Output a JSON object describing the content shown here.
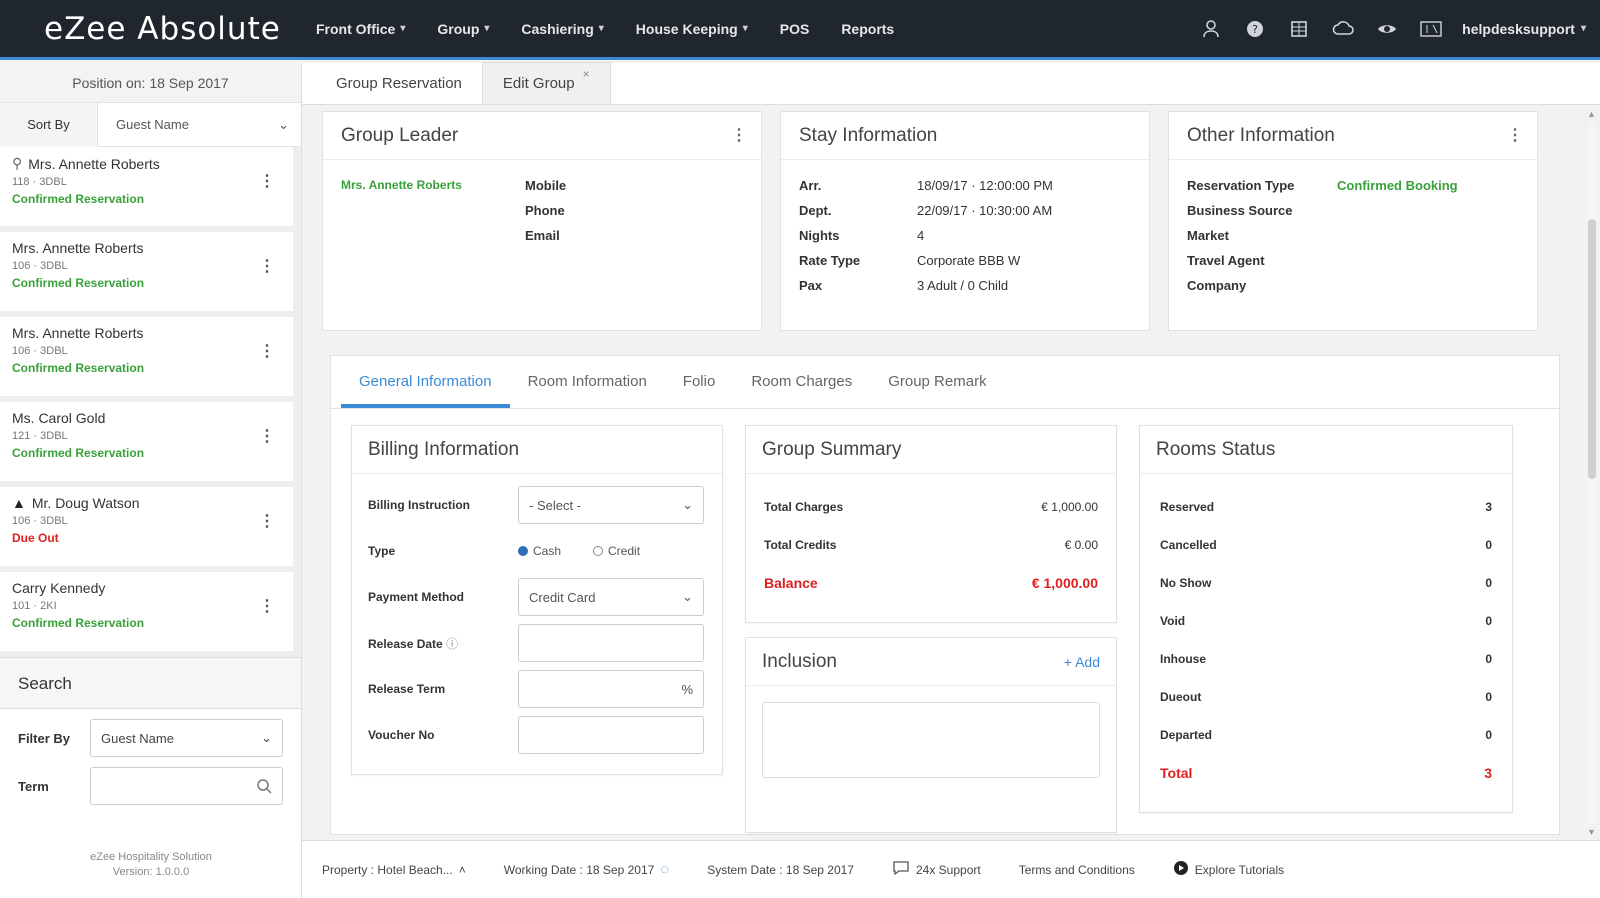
{
  "app": {
    "logo": "eZee Absolute"
  },
  "nav": {
    "menu": [
      "Front Office",
      "Group",
      "Cashiering",
      "House Keeping",
      "POS",
      "Reports"
    ],
    "menu_has_caret": [
      true,
      true,
      true,
      true,
      false,
      false
    ],
    "user": "helpdesksupport",
    "icons": [
      "user-icon",
      "help-icon",
      "grid-icon",
      "cloud-icon",
      "eye-icon",
      "language-icon"
    ]
  },
  "left": {
    "position_on": "Position on: 18 Sep 2017",
    "sort_label": "Sort By",
    "sort_value": "Guest Name",
    "reservations": [
      {
        "name": "Mrs. Annette Roberts",
        "sub": "118 · 3DBL",
        "status": "Confirmed Reservation",
        "status_color": "#3aa13a",
        "icon": "person-icon"
      },
      {
        "name": "Mrs. Annette Roberts",
        "sub": "106 · 3DBL",
        "status": "Confirmed Reservation",
        "status_color": "#3aa13a",
        "icon": ""
      },
      {
        "name": "Mrs. Annette Roberts",
        "sub": "106 · 3DBL",
        "status": "Confirmed Reservation",
        "status_color": "#3aa13a",
        "icon": ""
      },
      {
        "name": "Ms. Carol Gold",
        "sub": "121 · 3DBL",
        "status": "Confirmed Reservation",
        "status_color": "#3aa13a",
        "icon": ""
      },
      {
        "name": "Mr. Doug Watson",
        "sub": "106 · 3DBL",
        "status": "Due Out",
        "status_color": "#e02020",
        "icon": "warning-icon"
      },
      {
        "name": "Carry Kennedy",
        "sub": "101 · 2KI",
        "status": "Confirmed Reservation",
        "status_color": "#3aa13a",
        "icon": ""
      }
    ],
    "search_title": "Search",
    "filter_label": "Filter By",
    "filter_value": "Guest Name",
    "term_label": "Term",
    "footer_line1": "eZee Hospitality Solution",
    "footer_line2": "Version: 1.0.0.0"
  },
  "top_tabs": [
    {
      "label": "Group Reservation",
      "active": false
    },
    {
      "label": "Edit Group",
      "active": true,
      "closable": true
    }
  ],
  "group_leader": {
    "title": "Group Leader",
    "name": "Mrs. Annette Roberts",
    "fields": [
      "Mobile",
      "Phone",
      "Email"
    ]
  },
  "stay_info": {
    "title": "Stay Information",
    "rows": [
      {
        "k": "Arr.",
        "v": "18/09/17 · 12:00:00 PM"
      },
      {
        "k": "Dept.",
        "v": "22/09/17 · 10:30:00 AM"
      },
      {
        "k": "Nights",
        "v": "4"
      },
      {
        "k": "Rate Type",
        "v": "Corporate BBB W"
      },
      {
        "k": "Pax",
        "v": "3 Adult / 0 Child"
      }
    ]
  },
  "other_info": {
    "title": "Other Information",
    "rows": [
      {
        "k": "Reservation Type",
        "v": "Confirmed Booking"
      },
      {
        "k": "Business Source",
        "v": ""
      },
      {
        "k": "Market",
        "v": ""
      },
      {
        "k": "Travel Agent",
        "v": ""
      },
      {
        "k": "Company",
        "v": ""
      }
    ]
  },
  "info_tabs": [
    "General Information",
    "Room Information",
    "Folio",
    "Room Charges",
    "Group Remark"
  ],
  "billing": {
    "title": "Billing Information",
    "instruction_label": "Billing Instruction",
    "instruction_value": "- Select -",
    "type_label": "Type",
    "type_options": [
      "Cash",
      "Credit"
    ],
    "type_selected": "Cash",
    "payment_label": "Payment Method",
    "payment_value": "Credit Card",
    "release_date_label": "Release Date",
    "release_term_label": "Release Term",
    "release_term_suffix": "%",
    "voucher_label": "Voucher No"
  },
  "group_summary": {
    "title": "Group Summary",
    "total_charges_label": "Total Charges",
    "total_charges": "€ 1,000.00",
    "total_credits_label": "Total Credits",
    "total_credits": "€ 0.00",
    "balance_label": "Balance",
    "balance": "€ 1,000.00"
  },
  "inclusion": {
    "title": "Inclusion",
    "add_label": "+ Add"
  },
  "rooms_status": {
    "title": "Rooms Status",
    "rows": [
      {
        "k": "Reserved",
        "v": "3"
      },
      {
        "k": "Cancelled",
        "v": "0"
      },
      {
        "k": "No Show",
        "v": "0"
      },
      {
        "k": "Void",
        "v": "0"
      },
      {
        "k": "Inhouse",
        "v": "0"
      },
      {
        "k": "Dueout",
        "v": "0"
      },
      {
        "k": "Departed",
        "v": "0"
      }
    ],
    "total_label": "Total",
    "total_value": "3"
  },
  "statusbar": {
    "property": "Property : Hotel Beach...",
    "working_date": "Working Date : 18 Sep 2017",
    "system_date": "System Date : 18 Sep 2017",
    "support": "24x Support",
    "terms": "Terms and Conditions",
    "tutorials": "Explore Tutorials"
  },
  "colors": {
    "accent": "#3a8bd6",
    "nav_bg": "#1f262e",
    "green": "#3aa13a",
    "red": "#e02020"
  }
}
